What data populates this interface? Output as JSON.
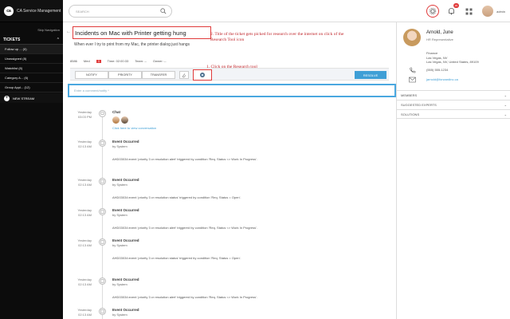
{
  "sidebar": {
    "logo": "ca",
    "logo_text": "CA Service Management",
    "skip_nav": "Skip Navigation",
    "tickets_label": "TICKETS",
    "items": [
      {
        "label": "Follow up ... (0)"
      },
      {
        "label": "Unassigned (8)"
      },
      {
        "label": "Watchlist (8)"
      },
      {
        "label": "Category A... (6)"
      },
      {
        "label": "Group Appl... (12)"
      }
    ],
    "new_stream": "NEW STREAM"
  },
  "header": {
    "search_placeholder": "SEARCH",
    "notif_count": "29",
    "user": "admin"
  },
  "ticket": {
    "title": "Incidents on Mac with Printer getting hung",
    "description": "When ever I try to print from my Mac, the printer dialog just hangs",
    "id": "8586",
    "priority_label": "Med",
    "priority_badge": "3",
    "time": "Time: 02:00:33",
    "team": "Team: --",
    "owner": "Owner: --",
    "actions": {
      "notify": "NOTIFY",
      "priority": "PRIORITY",
      "transfer": "TRANSFER",
      "resolve": "RESOLVE"
    },
    "comment_placeholder": "Enter a comment/notify *"
  },
  "annotations": {
    "a1": "1. Click on the Research tool",
    "a2": "2. Title of the ticket gets picked for research over the internet on click of the Research Tool icon"
  },
  "timeline": [
    {
      "time": "Chat",
      "date": "Chat",
      "title": "Chat",
      "by": "",
      "text": "",
      "link": "Click here to view conversation",
      "t1": "Yesterday",
      "t2": "03:03 PM"
    },
    {
      "title": "Event Occurred",
      "by": "by System",
      "text": "AHD03034:event 'priority 3 cr resolution alert' triggered by condition 'Req. Status <> Work In Progress'.",
      "t1": "Yesterday",
      "t2": "02:13 AM"
    },
    {
      "title": "Event Occurred",
      "by": "by System",
      "text": "AHD03034:event 'priority 3 cr resolution status' triggered by condition 'Req. Status = Open'.",
      "t1": "Yesterday",
      "t2": "02:13 AM"
    },
    {
      "title": "Event Occurred",
      "by": "by System",
      "text": "AHD03034:event 'priority 3 cr resolution alert' triggered by condition 'Req. Status <> Work In Progress'.",
      "t1": "Yesterday",
      "t2": "02:13 AM"
    },
    {
      "title": "Event Occurred",
      "by": "by System",
      "text": "AHD03034:event 'priority 3 cr resolution status' triggered by condition 'Req. Status = Open'.",
      "t1": "Yesterday",
      "t2": "02:13 AM"
    },
    {
      "title": "Event Occurred",
      "by": "by System",
      "text": "AHD03034:event 'priority 3 cr resolution alert' triggered by condition 'Req. Status <> Work In Progress'.",
      "t1": "Yesterday",
      "t2": "02:13 AM"
    },
    {
      "title": "Event Occurred",
      "by": "by System",
      "text": "",
      "t1": "Yesterday",
      "t2": "02:13 AM"
    }
  ],
  "contact": {
    "name": "Arnold, June",
    "role": "HR Representative",
    "dept": "Finance",
    "city": "Las Vegas, NV",
    "address": "Las Vegas, NV, United States, 89109",
    "phone": "(555) 555-1234",
    "email": "jarnold@forwardinc.ca"
  },
  "sections": [
    "MEMBERS",
    "SUGGESTED EXPERTS",
    "SOLUTIONS"
  ]
}
